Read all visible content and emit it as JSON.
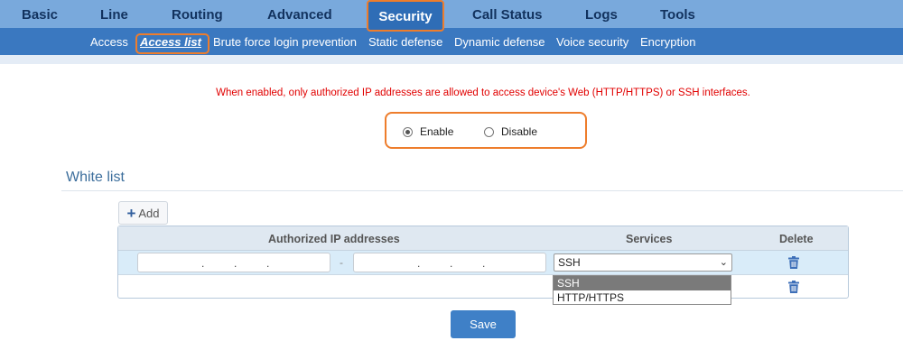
{
  "nav": {
    "tabs": [
      {
        "label": "Basic"
      },
      {
        "label": "Line"
      },
      {
        "label": "Routing"
      },
      {
        "label": "Advanced"
      },
      {
        "label": "Security"
      },
      {
        "label": "Call Status"
      },
      {
        "label": "Logs"
      },
      {
        "label": "Tools"
      }
    ],
    "active_tab": "Security"
  },
  "subnav": {
    "items": [
      {
        "label": "Access"
      },
      {
        "label": "Access list"
      },
      {
        "label": "Brute force login prevention"
      },
      {
        "label": "Static defense"
      },
      {
        "label": "Dynamic defense"
      },
      {
        "label": "Voice security"
      },
      {
        "label": "Encryption"
      }
    ],
    "active_item": "Access list"
  },
  "notice": "When enabled, only authorized IP addresses are allowed to access device's Web (HTTP/HTTPS) or SSH interfaces.",
  "access_control": {
    "enable_label": "Enable",
    "disable_label": "Disable",
    "selected": "Enable"
  },
  "white_list": {
    "title": "White list",
    "add_label": "Add",
    "columns": [
      "Authorized IP addresses",
      "Services",
      "Delete"
    ],
    "rows": [
      {
        "ip_start": "",
        "ip_end": "",
        "service": "SSH"
      },
      {
        "ip_start": "",
        "ip_end": "",
        "service": ""
      }
    ],
    "range_separator": "-",
    "service_options": [
      "SSH",
      "HTTP/HTTPS"
    ],
    "dropdown_open": true
  },
  "save_label": "Save",
  "colors": {
    "nav_bg": "#79a9dc",
    "nav_active_bg": "#2f6db6",
    "subnav_bg": "#3a78c0",
    "highlight": "#ee7d2c",
    "notice": "#e10000",
    "button": "#3f80c7"
  },
  "icons": {
    "add": "plus-icon",
    "delete": "trash-icon",
    "select": "chevron-down-icon"
  }
}
